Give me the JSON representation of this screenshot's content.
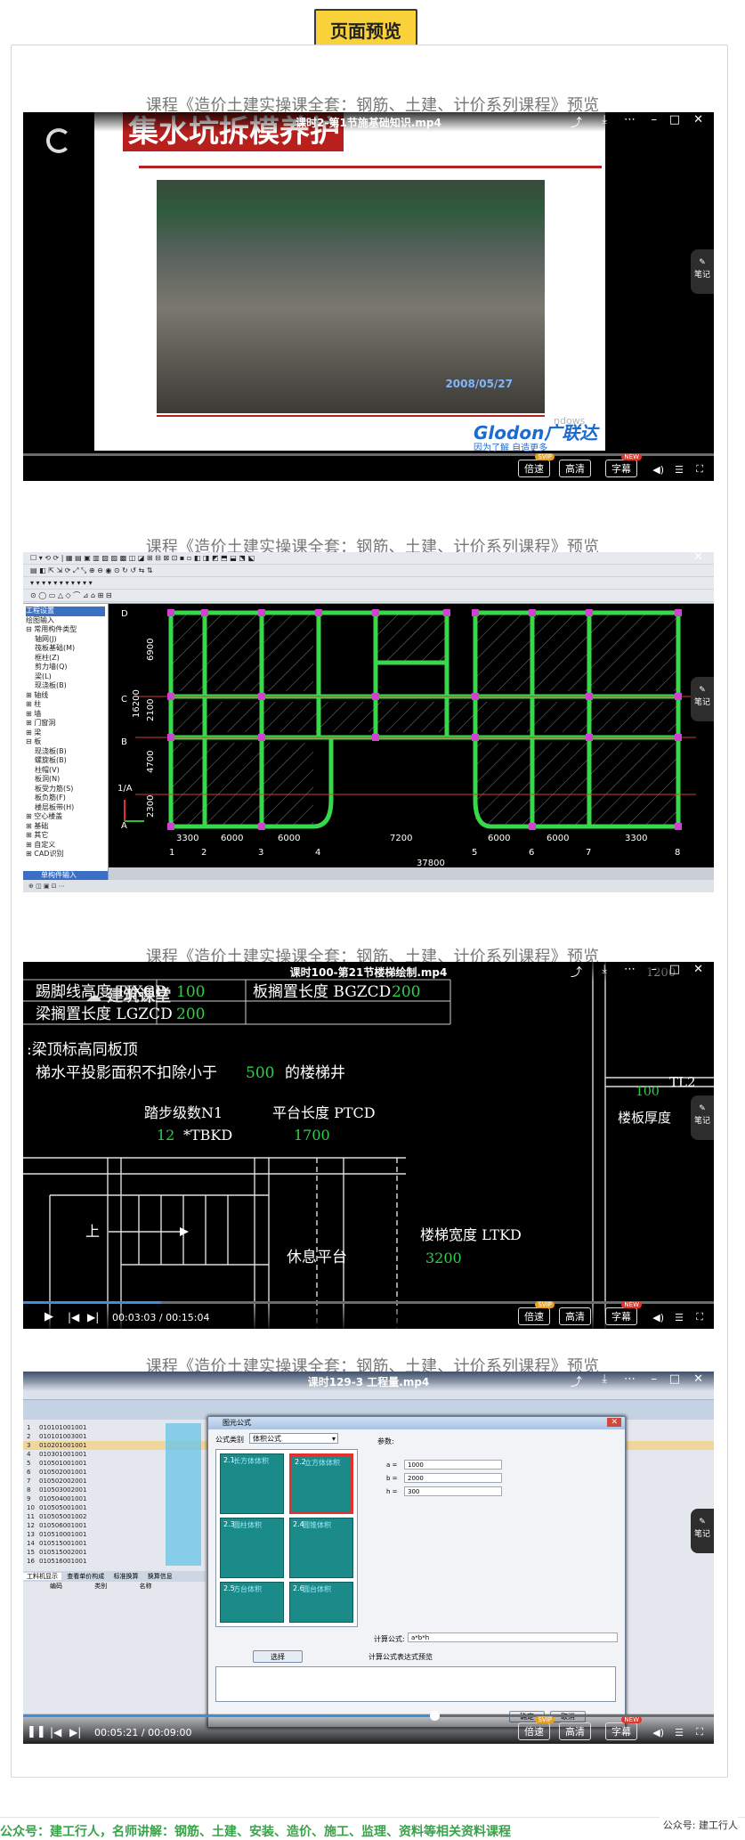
{
  "header": {
    "badge": "页面预览"
  },
  "videos": [
    {
      "course_title": "课程《造价土建实操课全套：钢筋、土建、计价系列课程》预览",
      "file_name": "课时2-第1节施基础知识.mp4",
      "slide_title": "集水坑拆模养护",
      "photo_date": "2008/05/27",
      "brand": "Glodon广联达",
      "slogan": "因为了解 自造更多",
      "watermark": "ndows"
    },
    {
      "course_title": "课程《造价土建实操课全套：钢筋、土建、计价系列课程》预览",
      "file_name": "",
      "tree_items": [
        "工程设置",
        "绘图输入",
        "常用构件类型",
        "轴网(J)",
        "筏板基础(M)",
        "框柱(Z)",
        "剪力墙(Q)",
        "梁(L)",
        "现浇板(B)",
        "轴线",
        "柱",
        "墙",
        "门窗洞",
        "梁",
        "板",
        "现浇板(B)",
        "螺旋板(B)",
        "柱帽(V)",
        "板洞(N)",
        "板受力筋(S)",
        "板负筋(F)",
        "楼层板带(H)",
        "空心楼盖",
        "基础",
        "其它",
        "自定义",
        "CAD识别"
      ],
      "bottom_tab": "单构件输入",
      "axis_left_dims": [
        "6900",
        "2100",
        "4700",
        "2300"
      ],
      "axis_total_left": "16200",
      "axis_left_labels": [
        "D",
        "C",
        "B",
        "1/A",
        "A"
      ],
      "axis_bottom_dims": [
        "3300",
        "6000",
        "6000",
        "7200",
        "6000",
        "6000",
        "3300"
      ],
      "axis_bottom_labels": [
        "1",
        "2",
        "3",
        "4",
        "5",
        "6",
        "7",
        "8"
      ],
      "axis_total_bottom": "37800"
    },
    {
      "course_title": "课程《造价土建实操课全套：钢筋、土建、计价系列课程》预览",
      "file_name": "课时100-第21节楼梯绘制.mp4",
      "watermark": "建筑课堂",
      "row1_label": "踢脚线高度 TJXGD",
      "row1_value": "100",
      "row1b_label": "板搁置长度 BGZCD",
      "row1b_value": "200",
      "row2_label": "梁搁置长度 LGZCD",
      "row2_value": "200",
      "note_line1": ":梁顶标高同板顶",
      "note_line2_prefix": "梯水平投影面积不扣除小于",
      "note_line2_value": "500",
      "note_line2_suffix": "的楼梯井",
      "steps_label": "踏步级数N1",
      "steps_value": "12",
      "tbkd": "*TBKD",
      "platform_label": "平台长度 PTCD",
      "platform_value": "1700",
      "up_label": "上",
      "rest_label": "休息平台",
      "width_label": "楼梯宽度 LTKD",
      "width_value": "3200",
      "right_100": "100",
      "right_tl2": "TL2",
      "right_thickness": "楼板厚度",
      "right_1200": "1200",
      "time": "00:03:03 / 00:15:04",
      "progress": 0.2
    },
    {
      "course_title": "课程《造价土建实操课全套：钢筋、土建、计价系列课程》预览",
      "file_name": "课时129-3 工程量.mp4",
      "dialog_title": "图元公式",
      "formula_type_label": "公式类别",
      "formula_type_value": "体积公式",
      "params_label": "参数:",
      "params": [
        {
          "name": "a",
          "value": "1000"
        },
        {
          "name": "b",
          "value": "2000"
        },
        {
          "name": "h",
          "value": "300"
        }
      ],
      "thumbs": [
        {
          "id": "2.1",
          "name": "长方体体积"
        },
        {
          "id": "2.2",
          "name": "立方体体积"
        },
        {
          "id": "2.3",
          "name": "圆柱体积"
        },
        {
          "id": "2.4",
          "name": "圆锥体积"
        },
        {
          "id": "2.5",
          "name": "方台体积"
        },
        {
          "id": "2.6",
          "name": "圆台体积"
        }
      ],
      "calc_formula_label": "计算公式:",
      "calc_formula_value": "a*b*h",
      "select_button": "选择",
      "expr_desc": "计算公式表达式预览",
      "ok_button": "确定",
      "cancel_button": "取消",
      "time": "00:05:21 / 00:09:00",
      "progress": 0.595,
      "rows": [
        {
          "no": "1",
          "code": "010101001001"
        },
        {
          "no": "2",
          "code": "010101003001"
        },
        {
          "no": "3",
          "code": "010201001001"
        },
        {
          "no": "4",
          "code": "010301001001"
        },
        {
          "no": "5",
          "code": "010501001001"
        },
        {
          "no": "6",
          "code": "010502001001"
        },
        {
          "no": "7",
          "code": "010502002001"
        },
        {
          "no": "8",
          "code": "010503002001"
        },
        {
          "no": "9",
          "code": "010504001001"
        },
        {
          "no": "10",
          "code": "010505001001"
        },
        {
          "no": "11",
          "code": "010505001002"
        },
        {
          "no": "12",
          "code": "010506001001"
        },
        {
          "no": "13",
          "code": "010510001001"
        },
        {
          "no": "14",
          "code": "010515001001"
        },
        {
          "no": "15",
          "code": "010515002001"
        },
        {
          "no": "16",
          "code": "010516001001"
        }
      ],
      "bottom_tabs": [
        "工料机显示",
        "查看单价构成",
        "标准换算",
        "换算信息"
      ],
      "bottom_cols": [
        "编码",
        "类别",
        "名称"
      ]
    }
  ],
  "player_labels": {
    "speed": "倍速",
    "hd": "高清",
    "subtitle": "字幕",
    "svip": "SVIP",
    "new": "NEW",
    "note": "笔记"
  },
  "footer": {
    "left": "公众号：建工行人，名师讲解：钢筋、土建、安装、造价、施工、监理、资料等相关资料课程",
    "right": "公众号: 建工行人"
  }
}
